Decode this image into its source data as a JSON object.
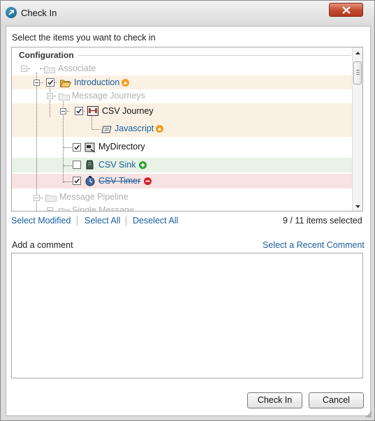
{
  "window": {
    "title": "Check In",
    "close_icon": "close-x-icon",
    "app_icon": "checkin-app-icon"
  },
  "instructions": "Select the items you want to check in",
  "tree": {
    "section_title": "Configuration",
    "items": [
      {
        "label": "Associate",
        "state": "disabled",
        "icon": "folder-icon"
      },
      {
        "label": "Introduction",
        "checked": true,
        "icon": "open-folder-icon",
        "status": "modified",
        "highlight": "#faf1e4"
      },
      {
        "label": "Message Journeys",
        "state": "disabled",
        "icon": "folder-icon"
      },
      {
        "label": "CSV Journey",
        "checked": true,
        "icon": "journey-icon",
        "highlight": "#faf1e4"
      },
      {
        "label": "Javascript",
        "icon": "script-icon",
        "status": "modified",
        "highlight": "#faf1e4"
      },
      {
        "label": "MyDirectory",
        "checked": true,
        "icon": "directory-icon"
      },
      {
        "label": "CSV Sink",
        "checked": false,
        "icon": "sink-icon",
        "status": "added",
        "highlight": "#e8f2e6"
      },
      {
        "label": "CSV Timer",
        "checked": true,
        "icon": "timer-icon",
        "status": "deleted",
        "highlight": "#f8e2e2"
      },
      {
        "label": "Message Pipeline",
        "state": "disabled",
        "icon": "folder-icon"
      },
      {
        "label": "Single Message",
        "state": "disabled",
        "icon": "folder-icon"
      }
    ]
  },
  "selection": {
    "select_modified": "Select Modified",
    "select_all": "Select All",
    "deselect_all": "Deselect All",
    "count_text": "9 / 11 items selected"
  },
  "comment": {
    "label": "Add a comment",
    "recent_link": "Select a Recent Comment",
    "value": ""
  },
  "buttons": {
    "check_in": "Check In",
    "cancel": "Cancel"
  },
  "colors": {
    "link": "#1a5fa0",
    "modified_badge": "#f0a020",
    "added_badge": "#2e9b2e",
    "deleted_badge": "#d0202a",
    "close_button": "#c24b2f"
  }
}
